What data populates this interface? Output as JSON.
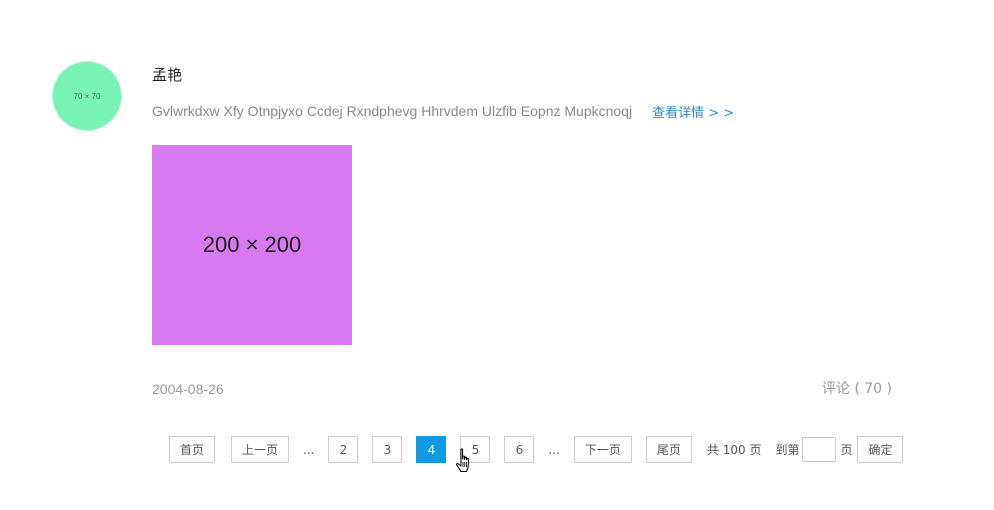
{
  "post": {
    "avatar_text": "70 × 70",
    "author": "孟艳",
    "description": "Gvlwrkdxw Xfy Otnpjyxo Ccdej Rxndphevg Hhrvdem Ulzfib Eopnz Mupkcnoqj",
    "detail_link": "查看详情 > >",
    "image_text": "200 × 200",
    "date": "2004-08-26",
    "comments": "评论 ( 70 )"
  },
  "pagination": {
    "first": "首页",
    "prev": "上一页",
    "ellipsis_left": "...",
    "pages": [
      "2",
      "3",
      "4",
      "5",
      "6"
    ],
    "current_page": "4",
    "ellipsis_right": "...",
    "next": "下一页",
    "last": "尾页",
    "total": "共 100 页",
    "goto_prefix": "到第",
    "goto_value": "",
    "goto_suffix": "页",
    "confirm": "确定"
  },
  "colors": {
    "avatar_bg": "#79f2b6",
    "image_bg": "#d979f2",
    "link": "#2a8ed0",
    "active_page": "#0f9be3"
  },
  "icons": {
    "cursor": "hand-pointer-icon"
  }
}
